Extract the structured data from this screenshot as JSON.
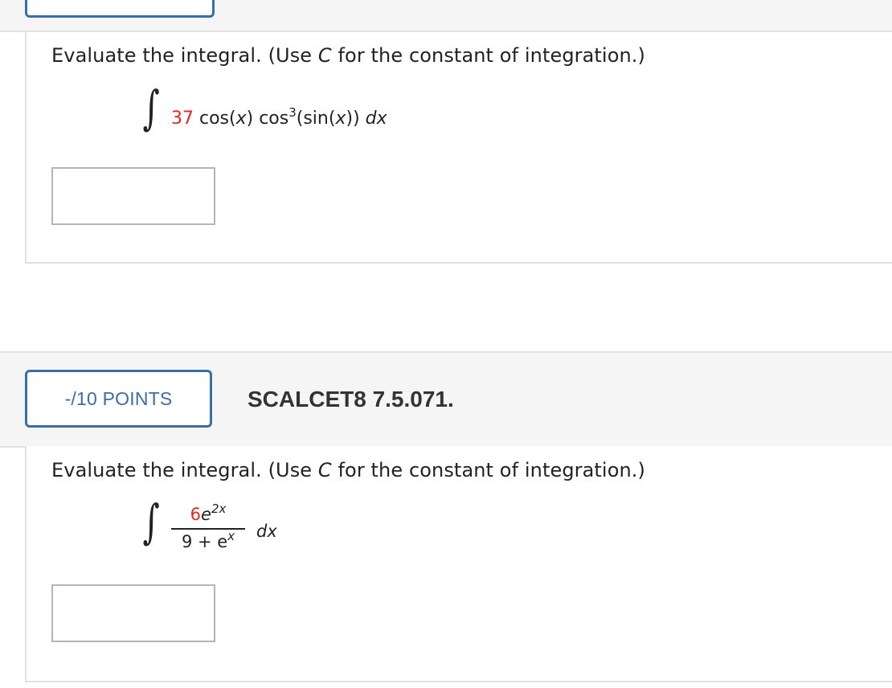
{
  "questions": [
    {
      "prompt_start": "Evaluate the integral. (Use ",
      "prompt_var": "C",
      "prompt_end": " for the constant of integration.)",
      "integral": {
        "coefficient": "37",
        "part1": " cos(",
        "var1": "x",
        "part2": ") cos",
        "power": "3",
        "part3": "(sin(",
        "var2": "x",
        "part4": ")) ",
        "differential": "dx"
      },
      "answer_value": ""
    },
    {
      "points": "-/10 POINTS",
      "problem_id": "SCALCET8 7.5.071.",
      "prompt_start": "Evaluate the integral. (Use ",
      "prompt_var": "C",
      "prompt_end": " for the constant of integration.)",
      "integral": {
        "numerator_coef": "6",
        "numerator_base": "e",
        "numerator_power": "2x",
        "denominator_const": "9 + e",
        "denominator_power": "x",
        "differential": "dx"
      },
      "answer_value": ""
    }
  ],
  "colors": {
    "accent": "#3a6ea5",
    "highlight_red": "#e0281e",
    "header_bg": "#f5f5f5"
  }
}
